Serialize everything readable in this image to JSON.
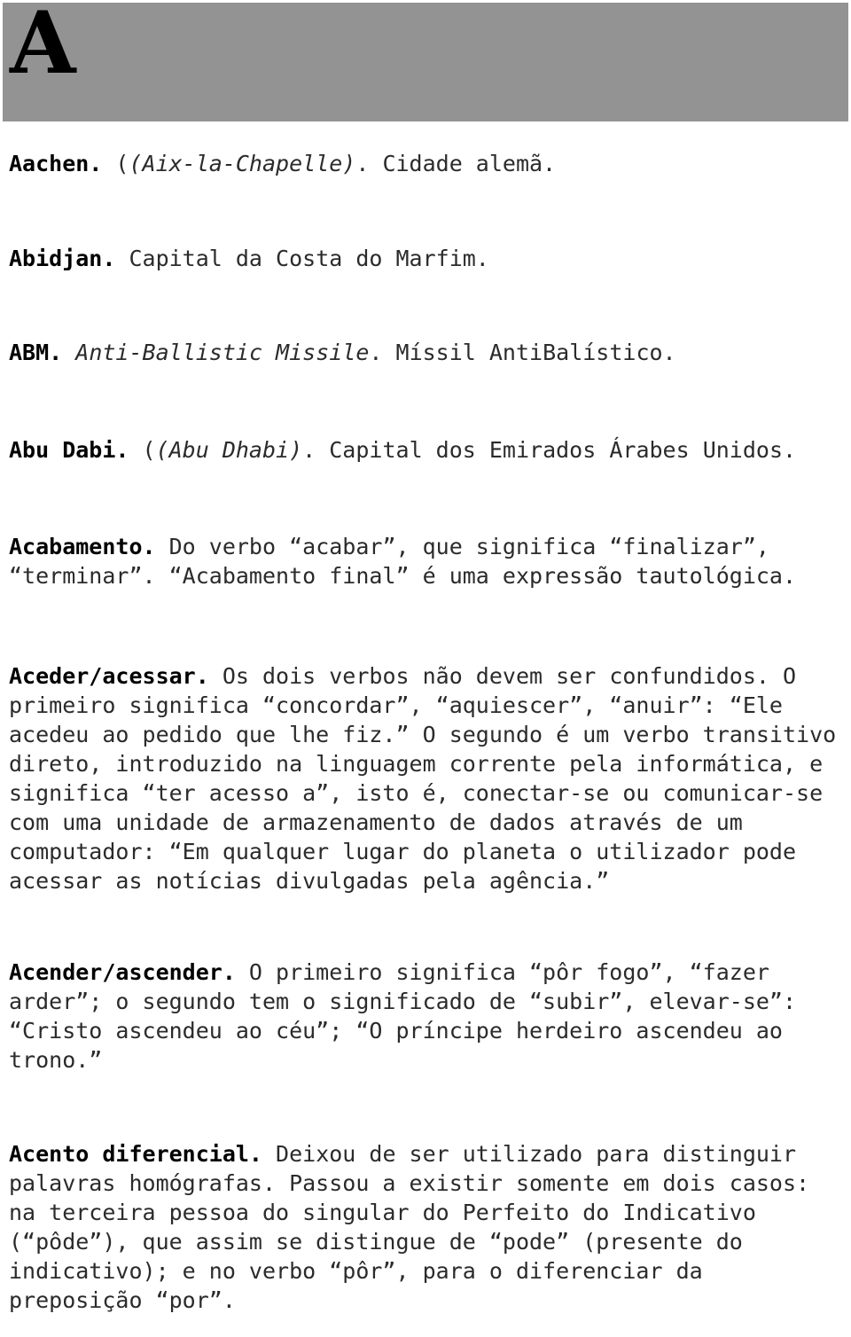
{
  "page": {
    "background_color": "#ffffff",
    "text_color": "#2b2b2b",
    "headword_color": "#000000"
  },
  "banner": {
    "letter": "A",
    "background_color": "#939393",
    "letter_color": "#000000"
  },
  "entries": [
    {
      "id": "aachen",
      "headword": "Aachen.",
      "italic": "(Aix-la-Chapelle)",
      "tail": ". Cidade alemã."
    },
    {
      "id": "abidjan",
      "headword": "Abidjan.",
      "body": " Capital da Costa do Marfim."
    },
    {
      "id": "abm",
      "headword": "ABM.",
      "italic": "Anti-Ballistic Missile",
      "tail": ". Míssil AntiBalístico."
    },
    {
      "id": "abudabi",
      "headword": "Abu Dabi.",
      "italic": "(Abu Dhabi)",
      "tail": ". Capital dos Emirados Árabes Unidos."
    },
    {
      "id": "acabamento",
      "headword": "Acabamento.",
      "body": " Do verbo “acabar”, que significa “finalizar”, “terminar”. “Acabamento final” é uma expressão tautológica."
    },
    {
      "id": "aceder",
      "headword": "Aceder/acessar.",
      "body": " Os dois verbos não devem ser confundidos. O primeiro significa “concordar”, “aquiescer”, “anuir”: “Ele acedeu ao pedido que lhe fiz.” O segundo é um verbo transitivo direto, introduzido na linguagem corrente pela informática, e significa “ter acesso a”, isto é, conectar-se ou comunicar-se com uma unidade de armazenamento de dados através de um computador: “Em qualquer lugar do planeta o utilizador pode acessar as notícias divulgadas pela agência.”"
    },
    {
      "id": "acender",
      "headword": "Acender/ascender.",
      "body": " O primeiro significa “pôr fogo”, “fazer arder”; o segundo tem o significado de “subir”, elevar-se”: “Cristo ascendeu ao céu”; “O príncipe herdeiro ascendeu ao trono.”"
    },
    {
      "id": "acento",
      "headword": "Acento diferencial.",
      "body": " Deixou de ser utilizado para distinguir palavras homógrafas. Passou a existir somente em dois casos: na terceira pessoa do singular do Perfeito do Indicativo (“pôde”), que assim se distingue de “pode” (presente do indicativo); e no verbo “pôr”, para o diferenciar da preposição “por”."
    }
  ]
}
